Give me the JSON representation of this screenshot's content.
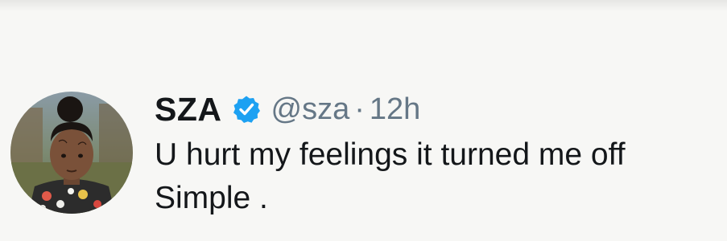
{
  "tweet": {
    "display_name": "SZA",
    "verified": true,
    "handle": "@sza",
    "separator": "·",
    "timestamp": "12h",
    "text_lines": [
      "U hurt my feelings it turned me off",
      "Simple ."
    ]
  },
  "colors": {
    "verified_badge": "#1da1f2",
    "name_text": "#14171a",
    "secondary_text": "#657786",
    "background": "#f7f7f5"
  },
  "icons": {
    "verified": "verified-badge-icon",
    "avatar": "profile-photo-child"
  }
}
